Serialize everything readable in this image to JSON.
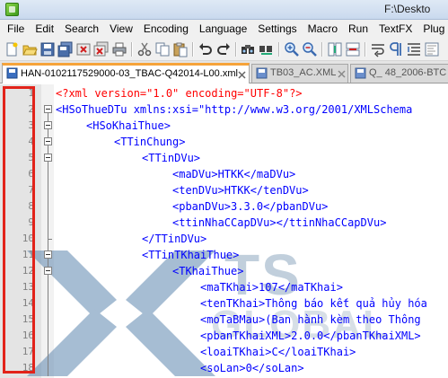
{
  "window": {
    "title": "F:\\Deskto"
  },
  "menu": [
    "File",
    "Edit",
    "Search",
    "View",
    "Encoding",
    "Language",
    "Settings",
    "Macro",
    "Run",
    "TextFX",
    "Plug"
  ],
  "tabs": [
    {
      "label": "HAN-0102117529000-03_TBAC-Q42014-L00.xml",
      "active": true
    },
    {
      "label": "TB03_AC.XML",
      "active": false
    },
    {
      "label": "Q_ 48_2006-BTC (",
      "active": false
    }
  ],
  "watermark": {
    "text_top": "TS",
    "text_bottom": "GLOBAL"
  },
  "code_lines": [
    {
      "num": "1",
      "text": "<?xml version=\"1.0\" encoding=\"UTF-8\"?>"
    },
    {
      "num": "2",
      "text": "<HSoThueDTu xmlns:xsi=\"http://www.w3.org/2001/XMLSchema"
    },
    {
      "num": "3",
      "text": "<HSoKhaiThue>"
    },
    {
      "num": "4",
      "text": "<TTinChung>"
    },
    {
      "num": "5",
      "text": "<TTinDVu>"
    },
    {
      "num": "6",
      "text": "<maDVu>HTKK</maDVu>"
    },
    {
      "num": "7",
      "text": "<tenDVu>HTKK</tenDVu>"
    },
    {
      "num": "8",
      "text": "<pbanDVu>3.3.0</pbanDVu>"
    },
    {
      "num": "9",
      "text": "<ttinNhaCCapDVu></ttinNhaCCapDVu>"
    },
    {
      "num": "10",
      "text": "</TTinDVu>"
    },
    {
      "num": "11",
      "text": "<TTinTKhaiThue>"
    },
    {
      "num": "12",
      "text": "<TKhaiThue>"
    },
    {
      "num": "13",
      "text": "<maTKhai>107</maTKhai>"
    },
    {
      "num": "14",
      "text": "<tenTKhai>Thông báo kết quả hủy hóa"
    },
    {
      "num": "15",
      "text": "<moTaBMau>(Ban hành kèm theo Thông"
    },
    {
      "num": "16",
      "text": "<pbanTKhaiXML>2.0.0</pbanTKhaiXML>"
    },
    {
      "num": "17",
      "text": "<loaiTKhai>C</loaiTKhai>"
    },
    {
      "num": "18",
      "text": "<soLan>0</soLan>"
    }
  ],
  "colors": {
    "tag": "#0000ff",
    "attribute": "#ff0000",
    "string": "#8000ff",
    "active_tab_accent": "#f6a33a",
    "annotation_box": "#e2231a"
  }
}
